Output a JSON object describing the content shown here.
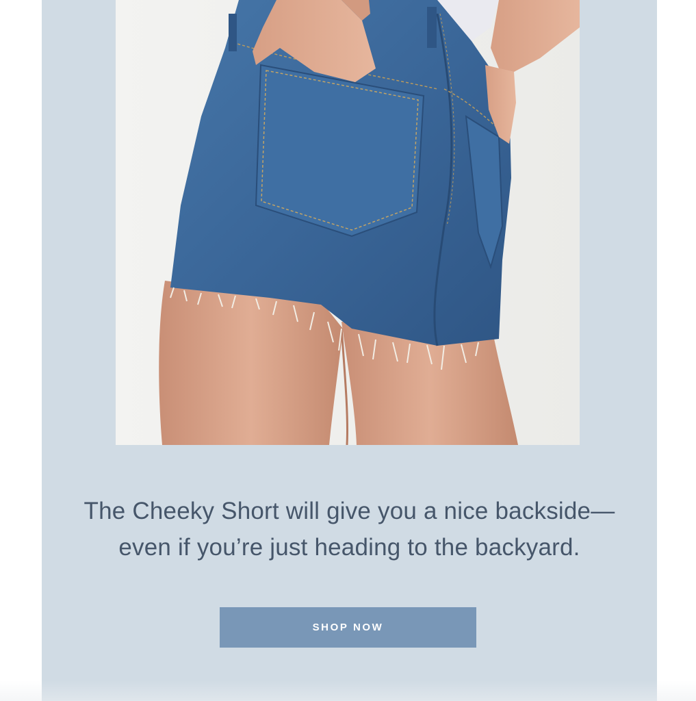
{
  "email": {
    "hero": {
      "image_subject": "Rear view of a person wearing frayed-hem denim cutoff shorts with hand in back pocket",
      "colors": {
        "background": "#f2f2f0",
        "denim": "#3c6a9c",
        "skin": "#d9a68d"
      }
    },
    "tagline": {
      "line1": "The Cheeky Short will give you a nice backside—",
      "line2": "even if you’re just heading to the backyard."
    },
    "cta": {
      "label": "SHOP NOW"
    },
    "colors": {
      "panel_background": "#d0dbe4",
      "text": "#46566a",
      "button": "#7997b7",
      "button_text": "#ffffff"
    }
  }
}
